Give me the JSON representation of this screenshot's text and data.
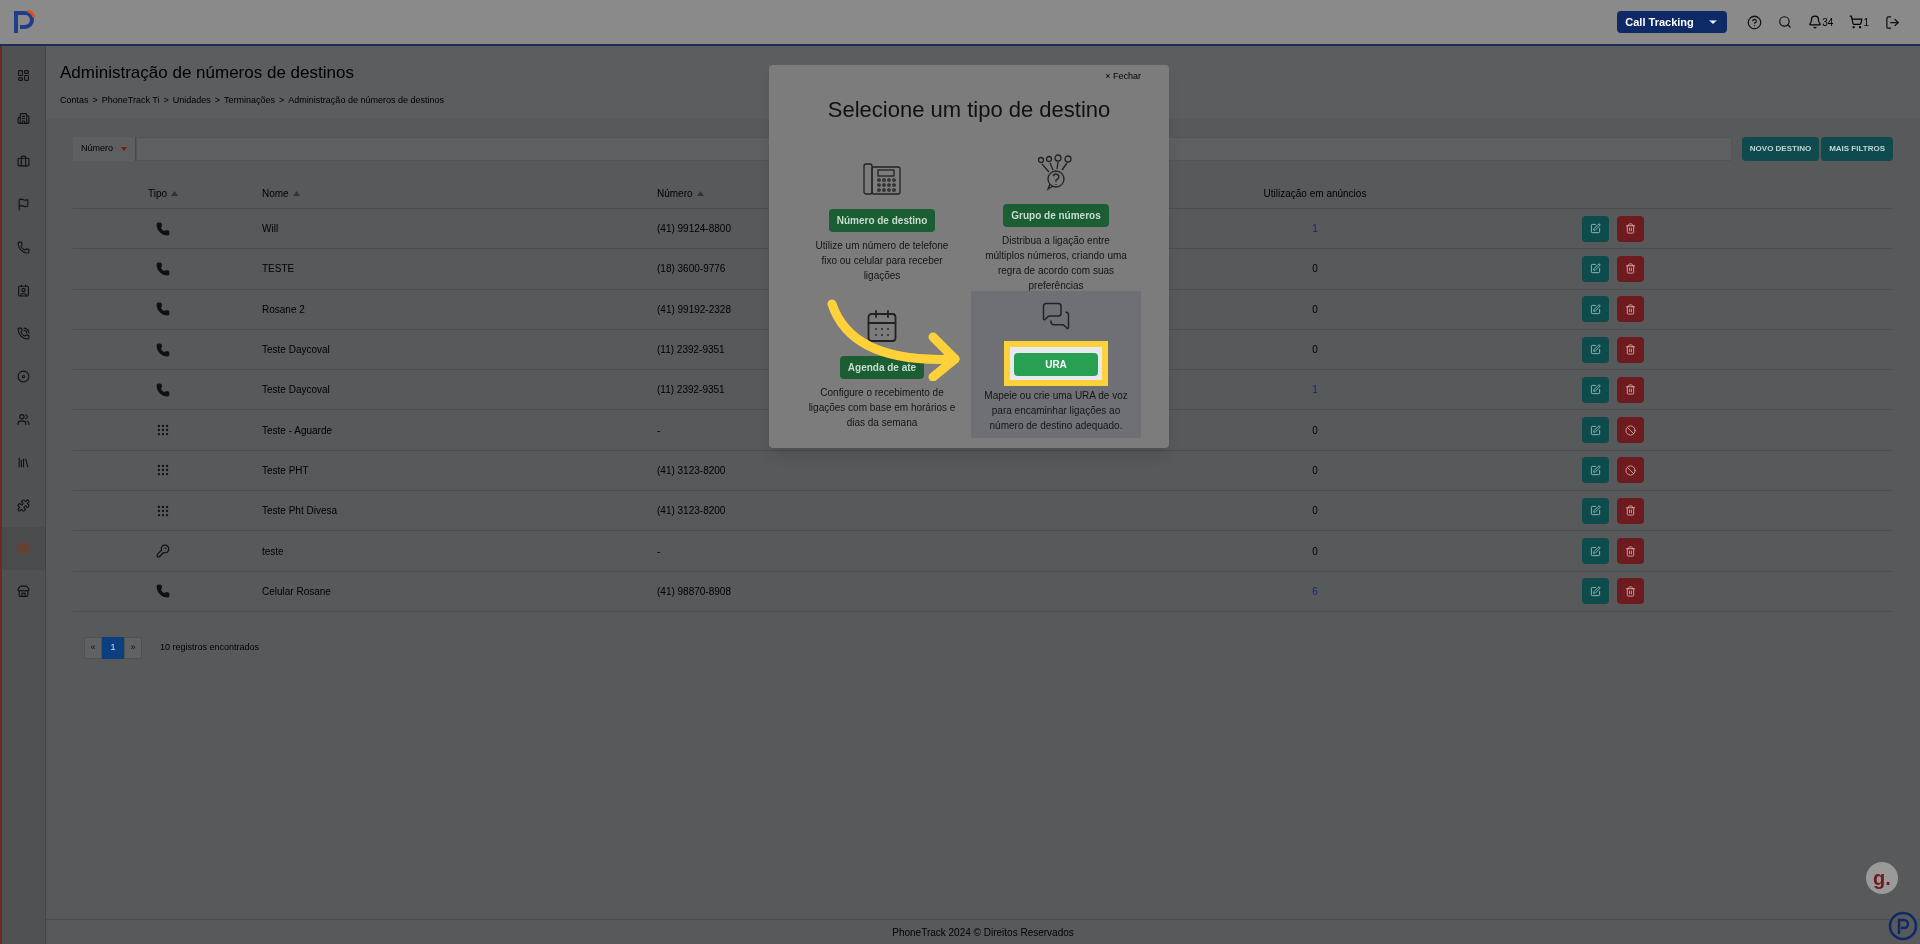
{
  "topbar": {
    "product_select": "Call Tracking",
    "notifications": "34",
    "cart": "1"
  },
  "sidebar": {
    "items": [
      {
        "selected": false
      },
      {
        "selected": false
      },
      {
        "selected": false
      },
      {
        "selected": false
      },
      {
        "selected": false
      },
      {
        "selected": false
      },
      {
        "selected": false
      },
      {
        "selected": false
      },
      {
        "selected": false
      },
      {
        "selected": false
      },
      {
        "selected": false
      },
      {
        "selected": true
      },
      {
        "selected": false
      }
    ]
  },
  "page": {
    "title": "Administração de números de destinos",
    "breadcrumb": [
      "Contas",
      "PhoneTrack Ti",
      "Unidades",
      "Terminações",
      "Administração de números de destinos"
    ],
    "separator": ">"
  },
  "filter": {
    "field": "Número",
    "buttons": [
      "NOVO DESTINO",
      "MAIS FILTROS"
    ]
  },
  "table": {
    "columns": [
      {
        "label": "Tipo",
        "sortable": true
      },
      {
        "label": "Nome",
        "sortable": true
      },
      {
        "label": "Número",
        "sortable": true
      },
      {
        "label": "Utilização em anúncios",
        "sortable": false
      }
    ],
    "rows": [
      {
        "kind": "phone",
        "name": "Will",
        "number": "(41) 99124-8800",
        "usage": "1",
        "usage_link": true,
        "blocked": false
      },
      {
        "kind": "phone",
        "name": "TESTE",
        "number": "(18) 3600-9776",
        "usage": "0",
        "usage_link": false,
        "blocked": false
      },
      {
        "kind": "phone",
        "name": "Rosane 2",
        "number": "(41) 99192-2328",
        "usage": "0",
        "usage_link": false,
        "blocked": false
      },
      {
        "kind": "phone",
        "name": "Teste Daycoval",
        "number": "(11) 2392-9351",
        "usage": "0",
        "usage_link": false,
        "blocked": false
      },
      {
        "kind": "phone",
        "name": "Teste Daycoval",
        "number": "(11) 2392-9351",
        "usage": "1",
        "usage_link": true,
        "blocked": false
      },
      {
        "kind": "keypad",
        "name": "Teste - Aguarde",
        "number": "-",
        "usage": "0",
        "usage_link": false,
        "blocked": true
      },
      {
        "kind": "keypad",
        "name": "Teste PHT",
        "number": "(41) 3123-8200",
        "usage": "0",
        "usage_link": false,
        "blocked": true
      },
      {
        "kind": "keypad",
        "name": "Teste Pht Divesa",
        "number": "(41) 3123-8200",
        "usage": "0",
        "usage_link": false,
        "blocked": false
      },
      {
        "kind": "key",
        "name": "teste",
        "number": "-",
        "usage": "0",
        "usage_link": false,
        "blocked": false
      },
      {
        "kind": "phone",
        "name": "Celular Rosane",
        "number": "(41) 98870-8908",
        "usage": "6",
        "usage_link": true,
        "blocked": false
      }
    ]
  },
  "pagination": {
    "prev": "«",
    "next": "»",
    "pages": [
      {
        "label": "1",
        "selected": true
      }
    ],
    "count": "10 registros encontrados"
  },
  "footer": "PhoneTrack 2024 © Direitos Reservados",
  "widget": {
    "letter": "g."
  },
  "modal": {
    "close": "× Fechar",
    "title": "Selecione um tipo de destino",
    "options": [
      {
        "kind": "desk-phone",
        "button": "Número de destino",
        "description": "Utilize um número de telefone fixo ou celular para receber ligações",
        "highlighted": false
      },
      {
        "kind": "group",
        "button": "Grupo de números",
        "description": "Distribua a ligação entre múltiplos números, criando uma regra de acordo com suas preferências",
        "highlighted": false
      },
      {
        "kind": "schedule",
        "button": "Agenda de ate",
        "description": "Configure o recebimento de ligações com base em horários e dias da semana",
        "highlighted": false
      },
      {
        "kind": "chat",
        "button": "URA",
        "description": "Mapeie ou crie uma URA de voz para encaminhar ligações ao número de destino adequado.",
        "highlighted": true
      }
    ]
  }
}
